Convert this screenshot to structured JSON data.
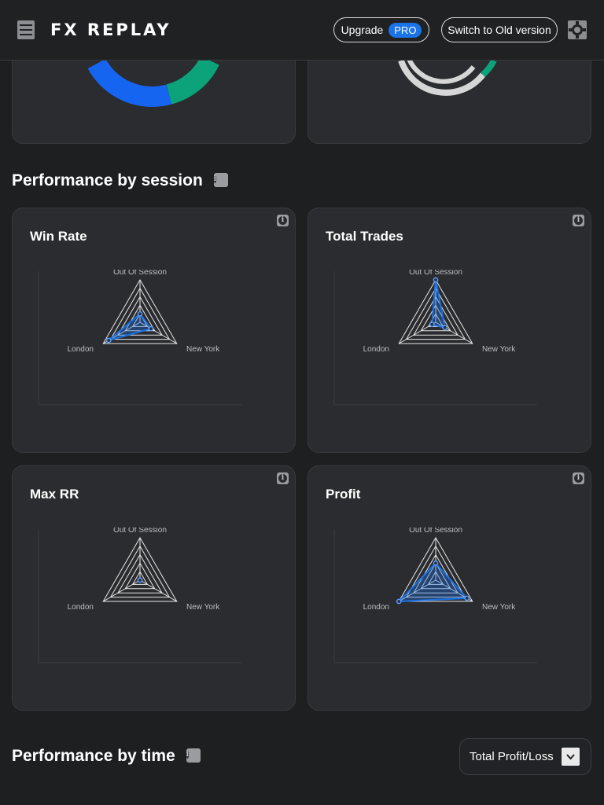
{
  "header": {
    "logo": "FX REPLAY",
    "upgrade_label": "Upgrade",
    "pro_badge": "PRO",
    "old_version_label": "Switch to Old version"
  },
  "colors": {
    "accent_blue": "#1a73e8",
    "donut_blue": "#1565f0",
    "donut_green": "#0da37a",
    "card_bg": "#2b2c2f",
    "page_bg": "#1e1f21"
  },
  "sections": {
    "session_title": "Performance by session",
    "time_title": "Performance by time"
  },
  "time_filter": {
    "selected": "Total Profit/Loss"
  },
  "chart_data": [
    {
      "type": "radar",
      "title": "Win Rate",
      "axes": [
        "Out Of Session",
        "New York",
        "London"
      ],
      "values": [
        0.2,
        0.3,
        0.85
      ]
    },
    {
      "type": "radar",
      "title": "Total Trades",
      "axes": [
        "Out Of Session",
        "New York",
        "London"
      ],
      "values": [
        1.0,
        0.25,
        0.1
      ]
    },
    {
      "type": "radar",
      "title": "Max RR",
      "axes": [
        "Out Of Session",
        "New York",
        "London"
      ],
      "values": [
        0.0,
        0.0,
        0.0
      ]
    },
    {
      "type": "radar",
      "title": "Profit",
      "axes": [
        "Out Of Session",
        "New York",
        "London"
      ],
      "values": [
        0.4,
        0.85,
        1.0
      ]
    }
  ]
}
